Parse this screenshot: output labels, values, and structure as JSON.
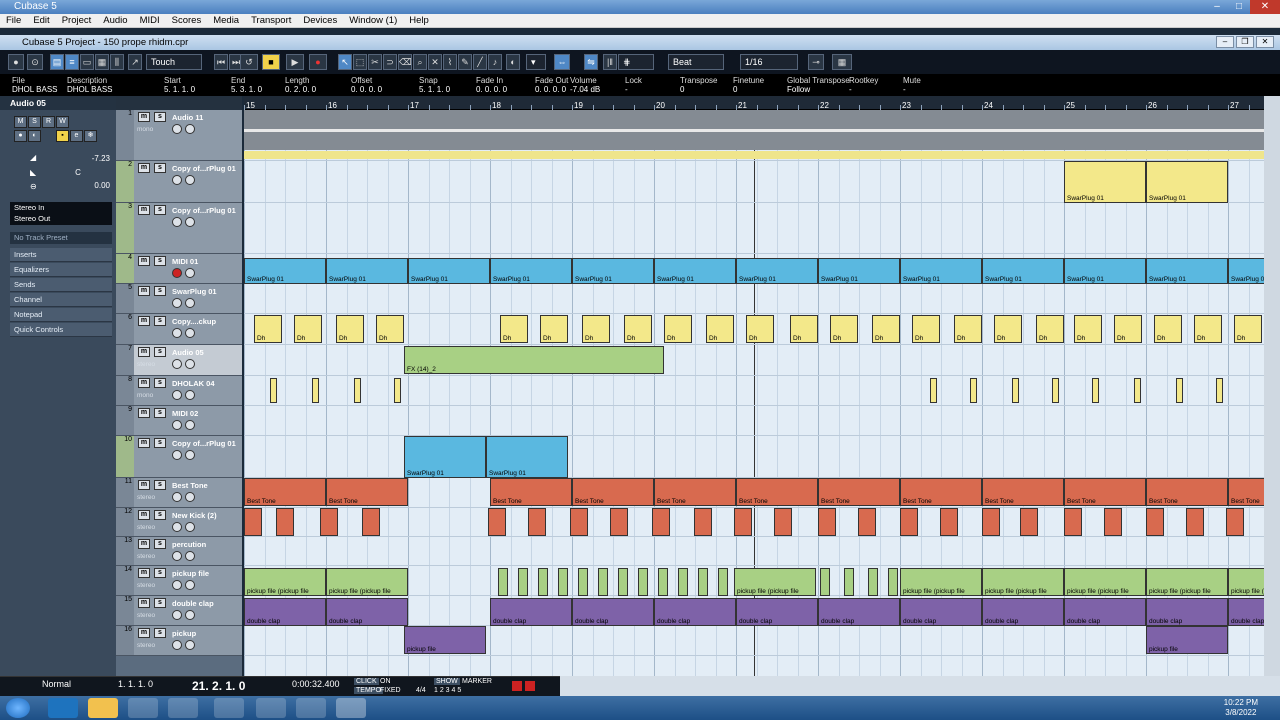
{
  "app": {
    "title": "Cubase 5",
    "project_title": "Cubase 5 Project - 150 prope rhidm.cpr"
  },
  "menu": [
    "File",
    "Edit",
    "Project",
    "Audio",
    "MIDI",
    "Scores",
    "Media",
    "Transport",
    "Devices",
    "Window (1)",
    "Help"
  ],
  "toolbar": {
    "automation_mode": "Touch",
    "snap_type": "Beat",
    "quantize": "1/16"
  },
  "infoline": {
    "cols": [
      {
        "label": "File",
        "value": "DHOL BASS"
      },
      {
        "label": "Description",
        "value": "DHOL BASS"
      },
      {
        "label": "Start",
        "value": "5. 1. 1.   0"
      },
      {
        "label": "End",
        "value": "5. 3. 1.   0"
      },
      {
        "label": "Length",
        "value": "0. 2. 0.   0"
      },
      {
        "label": "Offset",
        "value": "0. 0. 0.   0"
      },
      {
        "label": "Snap",
        "value": "5. 1. 1.   0"
      },
      {
        "label": "Fade In",
        "value": "0. 0. 0.   0"
      },
      {
        "label": "Fade Out",
        "value": "0. 0. 0.   0"
      },
      {
        "label": "Volume",
        "value": "-7.04 dB"
      },
      {
        "label": "Lock",
        "value": "-"
      },
      {
        "label": "Transpose",
        "value": "0"
      },
      {
        "label": "Finetune",
        "value": "0"
      },
      {
        "label": "Global Transpose",
        "value": "Follow"
      },
      {
        "label": "Rootkey",
        "value": "-"
      },
      {
        "label": "Mute",
        "value": "-"
      }
    ]
  },
  "inspector": {
    "track_name": "Audio 05",
    "volume": "-7.23",
    "pan": "C",
    "delay": "0.00",
    "input": "Stereo In",
    "output": "Stereo Out",
    "preset": "No Track Preset",
    "sections": [
      "Inserts",
      "Equalizers",
      "Sends",
      "Channel",
      "Notepad",
      "Quick Controls"
    ]
  },
  "tracks": [
    {
      "num": "1",
      "name": "Audio 11",
      "sub": "mono"
    },
    {
      "num": "2",
      "name": "Copy of...rPlug 01",
      "sub": ""
    },
    {
      "num": "3",
      "name": "Copy of...rPlug 01",
      "sub": ""
    },
    {
      "num": "4",
      "name": "MIDI 01",
      "sub": ""
    },
    {
      "num": "5",
      "name": "SwarPlug 01",
      "sub": ""
    },
    {
      "num": "6",
      "name": "Copy....ckup",
      "sub": ""
    },
    {
      "num": "7",
      "name": "Audio 05",
      "sub": "stereo"
    },
    {
      "num": "8",
      "name": "DHOLAK 04",
      "sub": "mono"
    },
    {
      "num": "9",
      "name": "MIDI 02",
      "sub": ""
    },
    {
      "num": "10",
      "name": "Copy of...rPlug 01",
      "sub": ""
    },
    {
      "num": "11",
      "name": "Best Tone",
      "sub": "stereo"
    },
    {
      "num": "12",
      "name": "New Kick (2)",
      "sub": "stereo"
    },
    {
      "num": "13",
      "name": "percution",
      "sub": "stereo"
    },
    {
      "num": "14",
      "name": "pickup file",
      "sub": "stereo"
    },
    {
      "num": "15",
      "name": "double clap",
      "sub": "stereo"
    },
    {
      "num": "16",
      "name": "pickup",
      "sub": "stereo"
    }
  ],
  "ruler": [
    "15",
    "16",
    "17",
    "18",
    "19",
    "20",
    "21",
    "22",
    "23",
    "24",
    "25",
    "26",
    "27"
  ],
  "parts": {
    "swarplug": "SwarPlug 01",
    "best_tone": "Best Tone",
    "pickup_file": "pickup file (pickup file",
    "double_clap": "double clap",
    "pickup": "pickup file",
    "fx": "FX (14)_2",
    "dh": "Dh"
  },
  "transport": {
    "mode": "Normal",
    "left_locator": "1. 1. 1.   0",
    "position": "21. 2. 1.   0",
    "time": "0:00:32.400",
    "click": "CLICK",
    "click_state": "ON",
    "tempo": "TEMPO",
    "tempo_state": "FIXED",
    "sig": "4/4",
    "show": "SHOW",
    "marker": "MARKER",
    "markers": "1 2 3 4 5"
  },
  "taskbar": {
    "time": "10:22 PM",
    "date": "3/8/2022"
  },
  "colors": {
    "accent": "#4f88c6",
    "yellow_part": "#f3e88a",
    "blue_part": "#5ab8e0",
    "red_part": "#d86a4f",
    "green_part": "#a8d084",
    "purple_part": "#7e62a8"
  }
}
